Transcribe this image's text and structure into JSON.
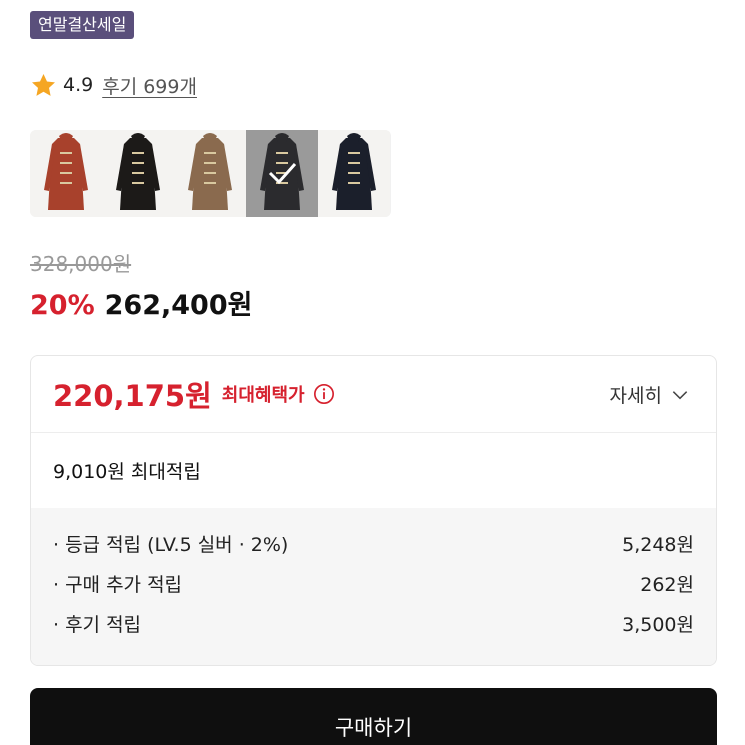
{
  "badge": {
    "label": "연말결산세일"
  },
  "rating": {
    "score": "4.9",
    "reviews": "후기 699개",
    "icon": "star-icon",
    "star_color": "#f5a623"
  },
  "swatches": [
    {
      "name": "swatch-red",
      "color": "#a8412c",
      "selected": false
    },
    {
      "name": "swatch-black",
      "color": "#1c1a18",
      "selected": false
    },
    {
      "name": "swatch-camel",
      "color": "#8a6a4e",
      "selected": false
    },
    {
      "name": "swatch-charcoal",
      "color": "#2b2b2e",
      "selected": true
    },
    {
      "name": "swatch-navy",
      "color": "#1b1f2b",
      "selected": false
    }
  ],
  "price": {
    "original": "328,000원",
    "discount": "20%",
    "sale": "262,400원",
    "accent_color": "#d6212e"
  },
  "benefit": {
    "price": "220,175원",
    "label": "최대혜택가",
    "details_label": "자세히",
    "max_points": "9,010원 최대적립",
    "items": [
      {
        "label": "· 등급 적립 (LV.5 실버 · 2%)",
        "value": "5,248원"
      },
      {
        "label": "· 구매 추가 적립",
        "value": "262원"
      },
      {
        "label": "· 후기 적립",
        "value": "3,500원"
      }
    ]
  },
  "buy_button": {
    "label": "구매하기"
  }
}
